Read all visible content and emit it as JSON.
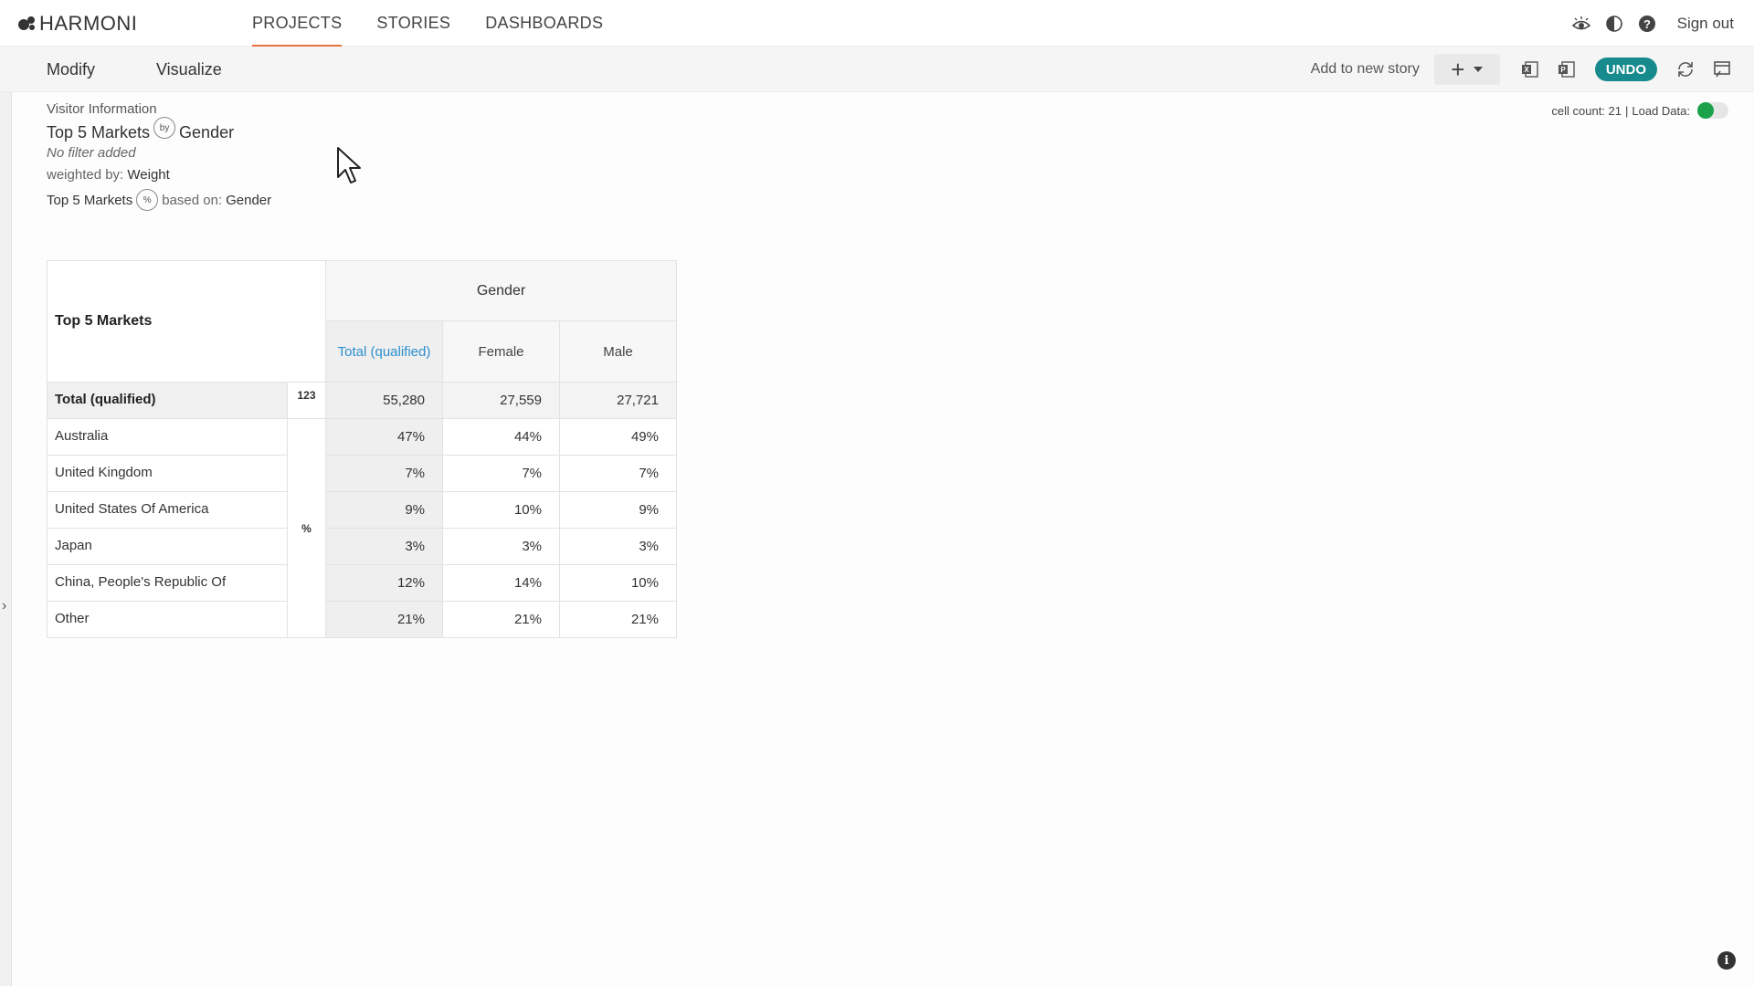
{
  "app": {
    "logo_text": "HARMONI"
  },
  "nav": {
    "items": [
      {
        "label": "PROJECTS",
        "active": true
      },
      {
        "label": "STORIES"
      },
      {
        "label": "DASHBOARDS"
      }
    ]
  },
  "topbar": {
    "sign_out": "Sign out",
    "icons": [
      "eye-icon",
      "contrast-icon",
      "help-icon"
    ]
  },
  "toolbar": {
    "tabs": [
      "Modify",
      "Visualize"
    ],
    "add_to_story": "Add to new story",
    "add_symbol": "+",
    "undo": "UNDO",
    "icons": [
      "excel-export-icon",
      "powerpoint-export-icon",
      "refresh-icon",
      "window-icon"
    ]
  },
  "info": {
    "source": "Visitor Information",
    "title_row": "Top 5 Markets",
    "by_badge": "by",
    "title_col": "Gender",
    "filter": "No filter added",
    "weighted_label": "weighted by:",
    "weighted_value": "Weight",
    "pct_row": "Top 5 Markets",
    "pct_badge": "%",
    "based_label": "based on:",
    "based_value": "Gender"
  },
  "status": {
    "cell_count": "cell count: 21",
    "separator": "|",
    "load_data": "Load Data:",
    "load_data_on": true,
    "toggle_color": "#1aa14a"
  },
  "table": {
    "corner": "Top 5 Markets",
    "group_header": "Gender",
    "columns": [
      "Total (qualified)",
      "Female",
      "Male"
    ],
    "total_row": {
      "label": "Total (qualified)",
      "stat": "123",
      "values": [
        "55,280",
        "27,559",
        "27,721"
      ]
    },
    "pct_stat": "%",
    "rows": [
      {
        "label": "Australia",
        "values": [
          "47%",
          "44%",
          "49%"
        ]
      },
      {
        "label": "United Kingdom",
        "values": [
          "7%",
          "7%",
          "7%"
        ]
      },
      {
        "label": "United States Of America",
        "values": [
          "9%",
          "10%",
          "9%"
        ]
      },
      {
        "label": "Japan",
        "values": [
          "3%",
          "3%",
          "3%"
        ]
      },
      {
        "label": "China, People's Republic Of",
        "values": [
          "12%",
          "14%",
          "10%"
        ]
      },
      {
        "label": "Other",
        "values": [
          "21%",
          "21%",
          "21%"
        ]
      }
    ]
  },
  "footer": {
    "info_symbol": "i"
  },
  "colors": {
    "accent": "#e8713c",
    "undo": "#168a8c",
    "link": "#2b8fd0"
  }
}
